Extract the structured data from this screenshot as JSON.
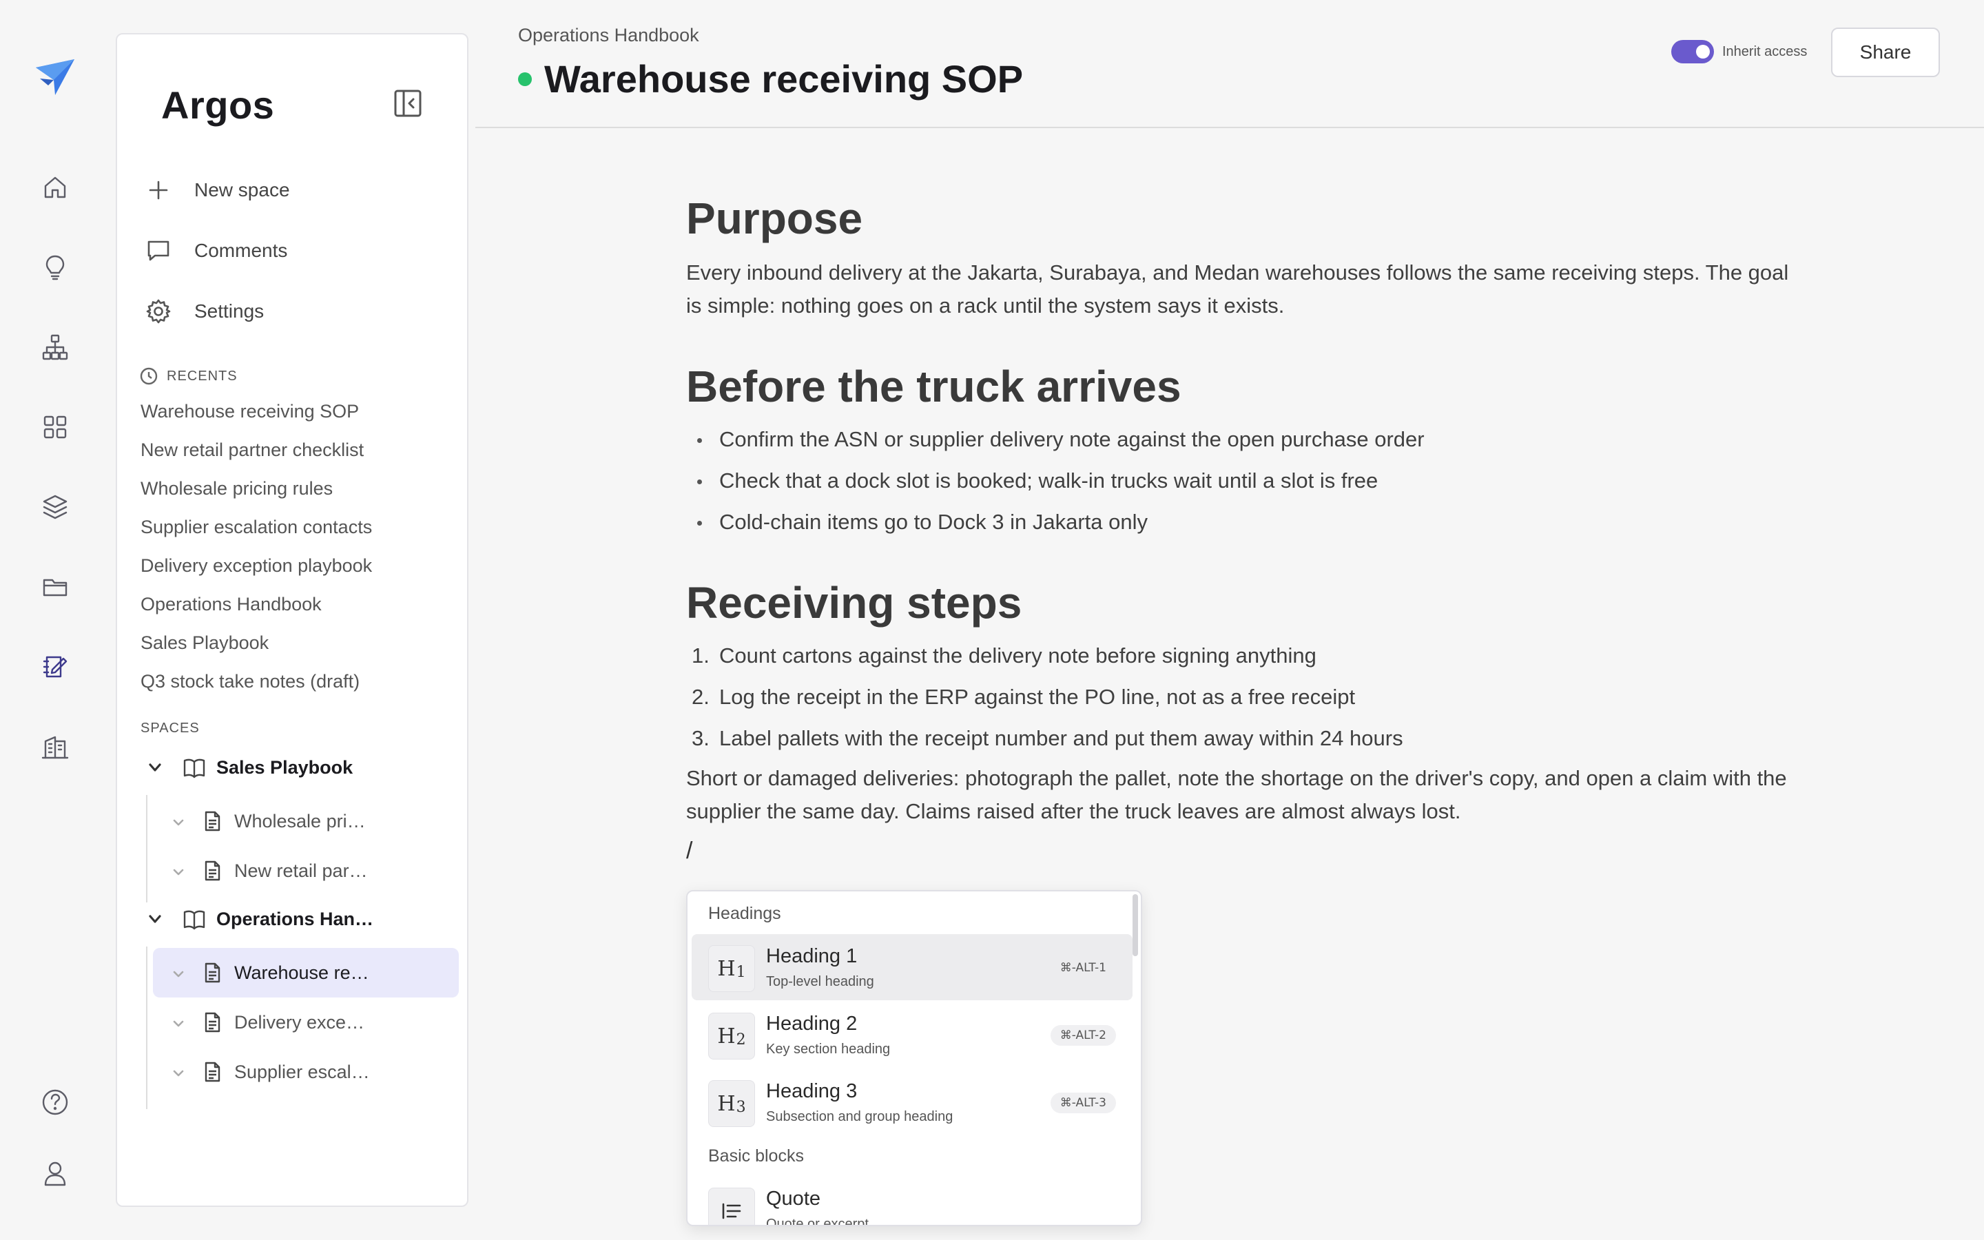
{
  "sidebar": {
    "title": "Argos",
    "actions": [
      {
        "label": "New space",
        "icon": "plus-icon"
      },
      {
        "label": "Comments",
        "icon": "comment-icon"
      },
      {
        "label": "Settings",
        "icon": "gear-icon"
      }
    ],
    "recents_heading": "RECENTS",
    "recents": [
      "Warehouse receiving SOP",
      "New retail partner checklist",
      "Wholesale pricing rules",
      "Supplier escalation contacts",
      "Delivery exception playbook",
      "Operations Handbook",
      "Sales Playbook",
      "Q3 stock take notes (draft)"
    ],
    "spaces_heading": "SPACES",
    "spaces": [
      {
        "label": "Sales Playbook",
        "pages": [
          "Wholesale pri…",
          "New retail par…"
        ]
      },
      {
        "label": "Operations Han…",
        "pages": [
          "Warehouse re…",
          "Delivery exce…",
          "Supplier escal…"
        ]
      }
    ]
  },
  "header": {
    "breadcrumb": "Operations Handbook",
    "title": "Warehouse receiving SOP",
    "status_color": "#27c26c",
    "inherit_label": "Inherit access",
    "inherit_on": true,
    "share_label": "Share"
  },
  "doc": {
    "sections": [
      {
        "heading": "Purpose",
        "paragraph": "Every inbound delivery at the Jakarta, Surabaya, and Medan warehouses follows the same receiving steps. The goal is simple: nothing goes on a rack until the system says it exists."
      },
      {
        "heading": "Before the truck arrives",
        "bullets": [
          "Confirm the ASN or supplier delivery note against the open purchase order",
          "Check that a dock slot is booked; walk-in trucks wait until a slot is free",
          "Cold-chain items go to Dock 3 in Jakarta only"
        ]
      },
      {
        "heading": "Receiving steps",
        "steps": [
          "Count cartons against the delivery note before signing anything",
          "Log the receipt in the ERP against the PO line, not as a free receipt",
          "Label pallets with the receipt number and put them away within 24 hours"
        ],
        "paragraph": "Short or damaged deliveries: photograph the pallet, note the shortage on the driver's copy, and open a claim with the supplier the same day. Claims raised after the truck leaves are almost always lost."
      }
    ],
    "slash_input": "/"
  },
  "slash_menu": {
    "group_headings": "Headings",
    "items": [
      {
        "glyph": "H",
        "level": "1",
        "title": "Heading 1",
        "subtitle": "Top-level heading",
        "shortcut": "⌘-ALT-1"
      },
      {
        "glyph": "H",
        "level": "2",
        "title": "Heading 2",
        "subtitle": "Key section heading",
        "shortcut": "⌘-ALT-2"
      },
      {
        "glyph": "H",
        "level": "3",
        "title": "Heading 3",
        "subtitle": "Subsection and group heading",
        "shortcut": "⌘-ALT-3"
      }
    ],
    "group_basic": "Basic blocks",
    "basic_items": [
      {
        "title": "Quote",
        "subtitle": "Quote or excerpt"
      }
    ]
  },
  "colors": {
    "accent": "#6a5acd",
    "active_page_bg": "#e9e9fb"
  }
}
